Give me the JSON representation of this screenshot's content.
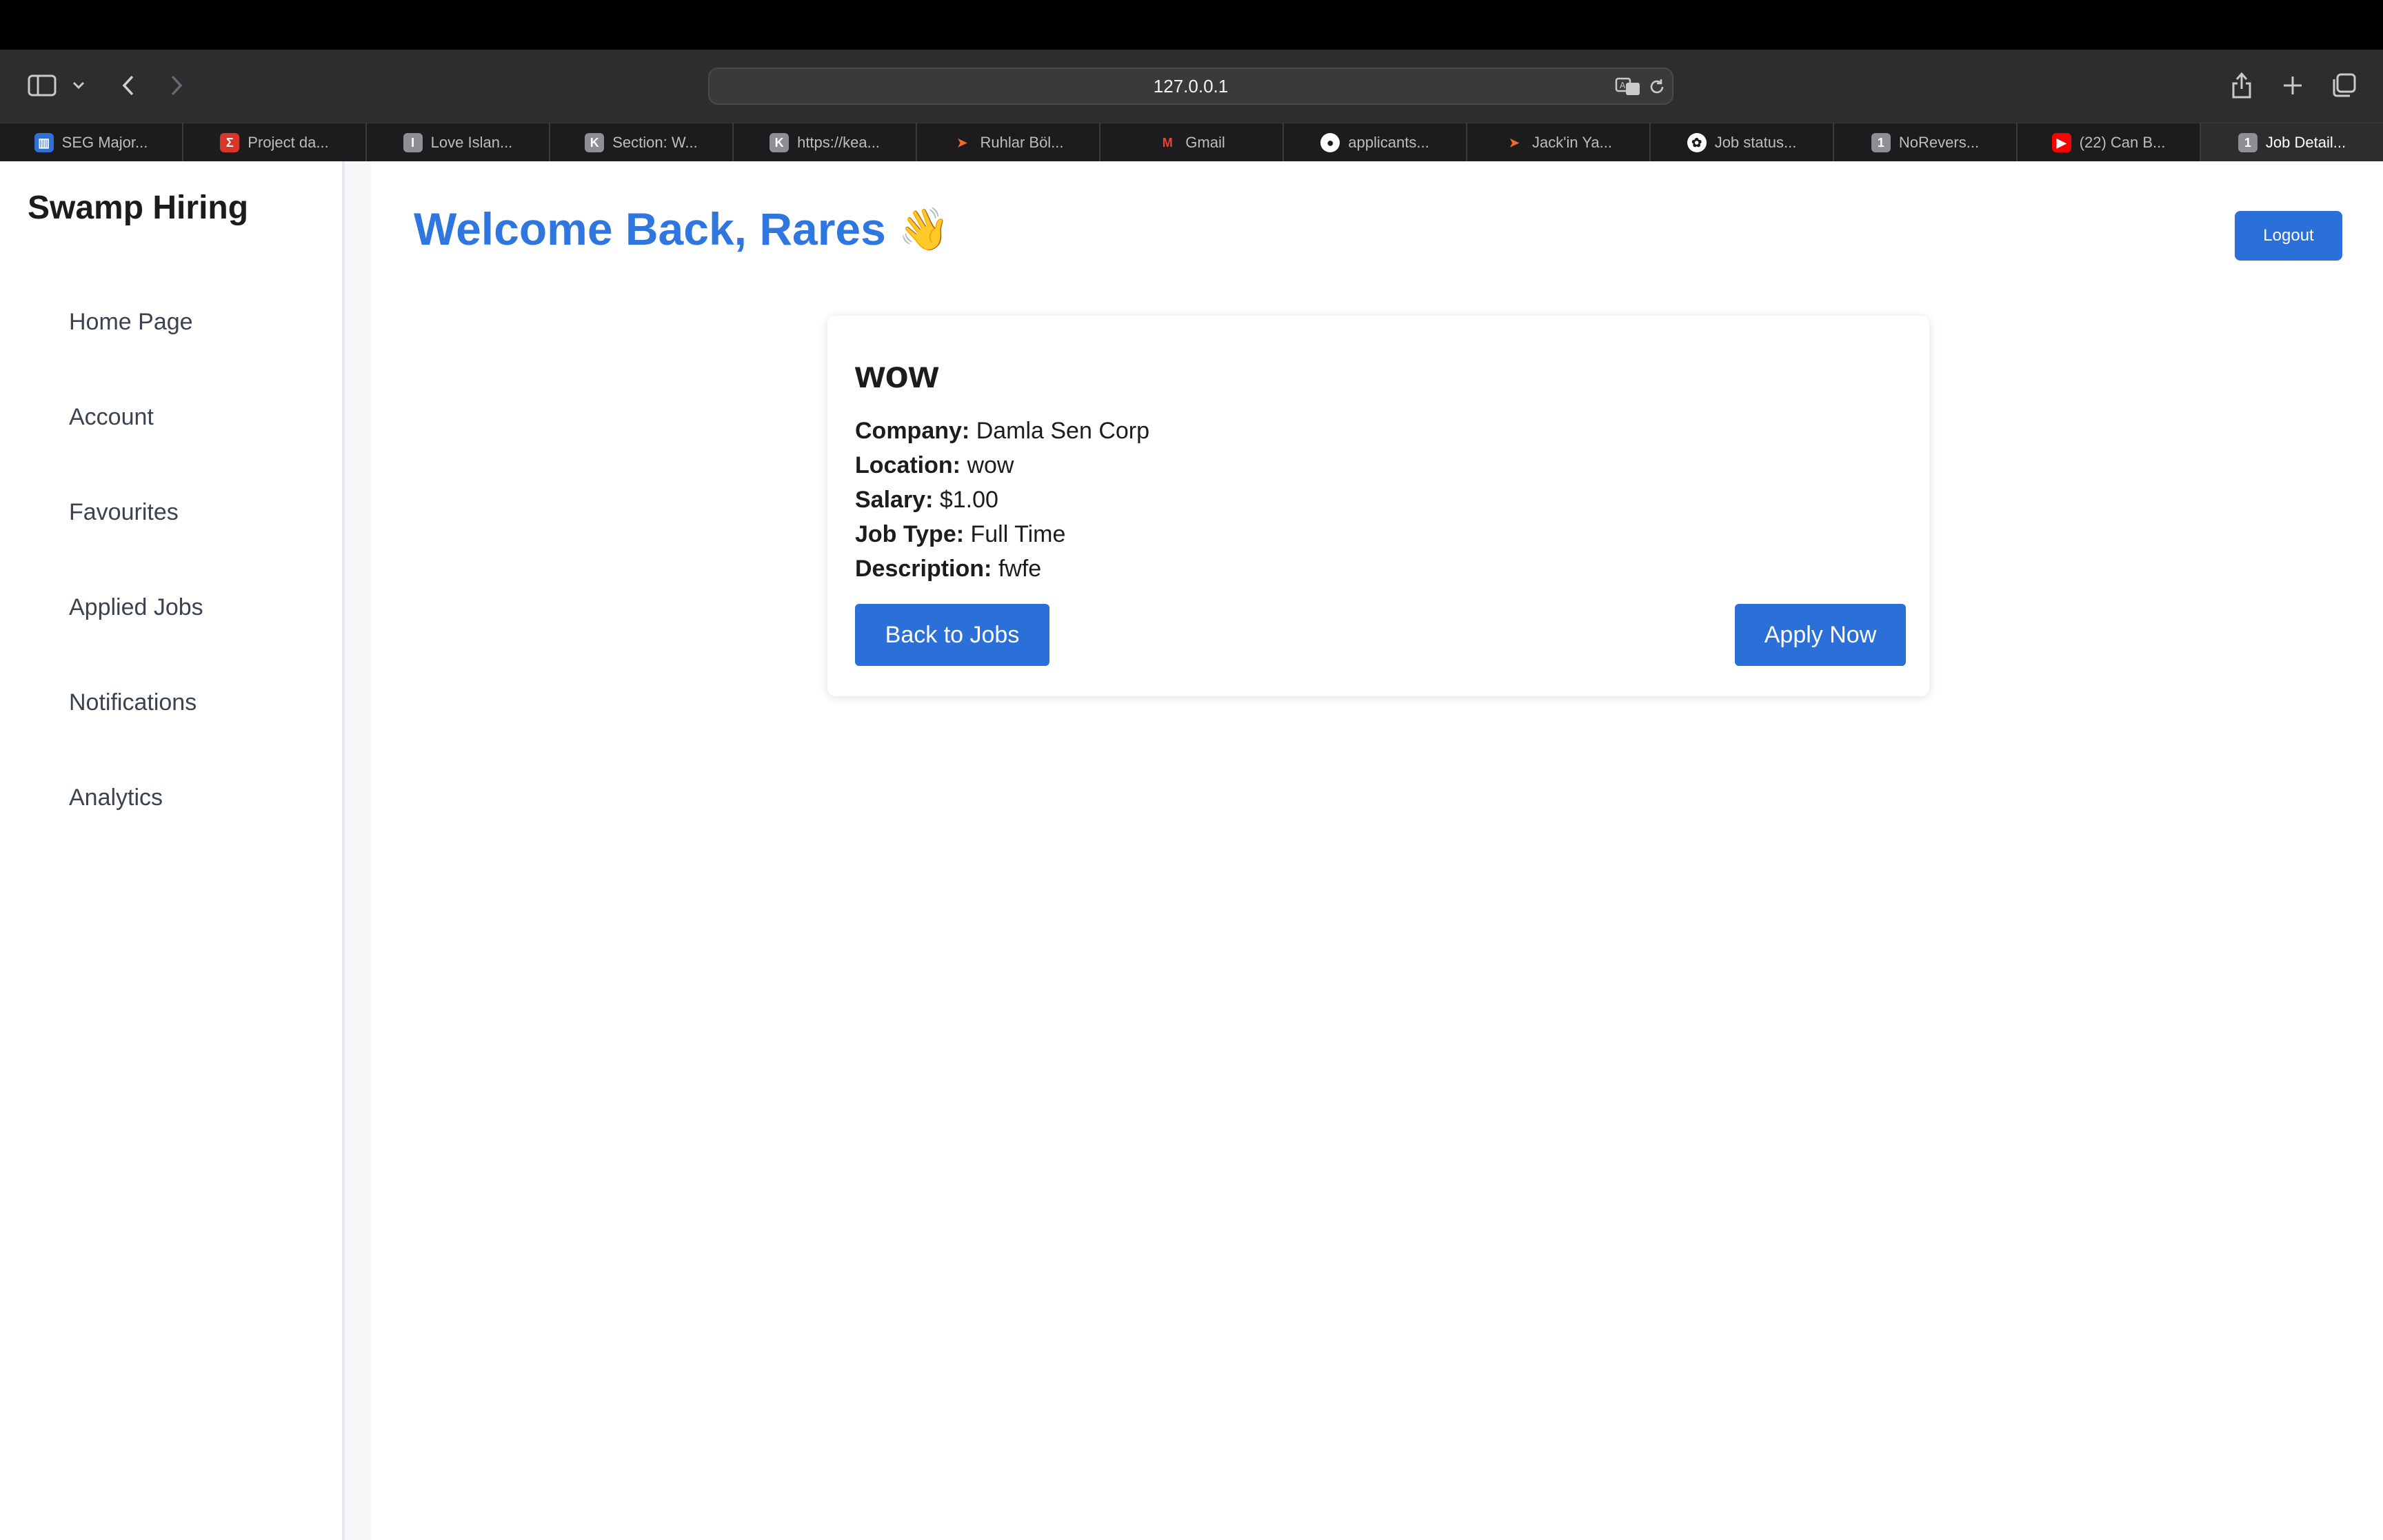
{
  "browser": {
    "url": "127.0.0.1",
    "tabs": [
      {
        "label": "SEG Major...",
        "icon": "trello-icon",
        "color": "#2f6fd6",
        "glyph": "▥"
      },
      {
        "label": "Project da...",
        "icon": "sigma-icon",
        "color": "#d9362b",
        "glyph": "Σ"
      },
      {
        "label": "Love Islan...",
        "icon": "letter-i-icon",
        "color": "#8e8e93",
        "glyph": "I"
      },
      {
        "label": "Section: W...",
        "icon": "letter-k-icon",
        "color": "#8e8e93",
        "glyph": "K"
      },
      {
        "label": "https://kea...",
        "icon": "letter-k-icon",
        "color": "#8e8e93",
        "glyph": "K"
      },
      {
        "label": "Ruhlar Böl...",
        "icon": "play-arrow-icon",
        "color": "#f06a28",
        "glyph": "➤"
      },
      {
        "label": "Gmail",
        "icon": "gmail-icon",
        "color": "#ea4335",
        "glyph": "M"
      },
      {
        "label": "applicants...",
        "icon": "github-icon",
        "color": "#ffffff",
        "glyph": "●"
      },
      {
        "label": "Jack'in Ya...",
        "icon": "play-arrow-icon",
        "color": "#f06a28",
        "glyph": "➤"
      },
      {
        "label": "Job status...",
        "icon": "openai-icon",
        "color": "#ffffff",
        "glyph": "✿"
      },
      {
        "label": "NoRevers...",
        "icon": "number-1-icon",
        "color": "#8e8e93",
        "glyph": "1"
      },
      {
        "label": "(22) Can B...",
        "icon": "youtube-icon",
        "color": "#ff0000",
        "glyph": "▶"
      },
      {
        "label": "Job Detail...",
        "icon": "number-1-icon",
        "color": "#8e8e93",
        "glyph": "1",
        "active": true
      }
    ]
  },
  "sidebar": {
    "brand": "Swamp Hiring",
    "items": [
      {
        "label": "Home Page"
      },
      {
        "label": "Account"
      },
      {
        "label": "Favourites"
      },
      {
        "label": "Applied Jobs"
      },
      {
        "label": "Notifications"
      },
      {
        "label": "Analytics"
      }
    ]
  },
  "header": {
    "welcome": "Welcome Back, Rares",
    "wave": "👋",
    "logout_label": "Logout"
  },
  "job": {
    "title": "wow",
    "fields": [
      {
        "label": "Company:",
        "value": "Damla Sen Corp"
      },
      {
        "label": "Location:",
        "value": "wow"
      },
      {
        "label": "Salary:",
        "value": "$1.00"
      },
      {
        "label": "Job Type:",
        "value": "Full Time"
      },
      {
        "label": "Description:",
        "value": "fwfe"
      }
    ],
    "back_label": "Back to Jobs",
    "apply_label": "Apply Now"
  },
  "colors": {
    "accent": "#2b6fd9",
    "heading_blue": "#2f76df"
  }
}
